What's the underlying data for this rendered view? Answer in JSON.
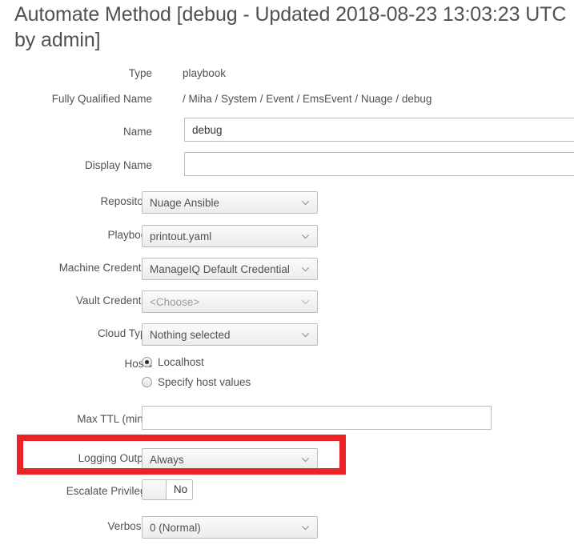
{
  "page": {
    "title": "Automate Method [debug - Updated 2018-08-23 13:03:23 UTC by admin]"
  },
  "colors": {
    "highlight": "#ec2227",
    "label_text": "#4d5258",
    "placeholder_text": "#9c9c9c"
  },
  "form": {
    "type": {
      "label": "Type",
      "value": "playbook"
    },
    "fully_qualified_name": {
      "label": "Fully Qualified Name",
      "value": "/ Miha / System / Event / EmsEvent / Nuage / debug"
    },
    "name": {
      "label": "Name",
      "value": "debug",
      "placeholder": ""
    },
    "display_name": {
      "label": "Display Name",
      "value": "",
      "placeholder": ""
    },
    "repository": {
      "label": "Repository",
      "value": "Nuage Ansible"
    },
    "playbook": {
      "label": "Playbook",
      "value": "printout.yaml"
    },
    "machine_credential": {
      "label": "Machine Credential",
      "value": "ManageIQ Default Credential"
    },
    "vault_credential": {
      "label": "Vault Credential",
      "value": "<Choose>"
    },
    "cloud_type": {
      "label": "Cloud Type",
      "value": "Nothing selected"
    },
    "hosts": {
      "label": "Hosts",
      "options": [
        {
          "label": "Localhost",
          "selected": true
        },
        {
          "label": "Specify host values",
          "selected": false
        }
      ]
    },
    "max_ttl": {
      "label": "Max TTL (mins)",
      "value": "",
      "placeholder": ""
    },
    "logging_output": {
      "label": "Logging Output",
      "value": "Always"
    },
    "escalate_privilege": {
      "label": "Escalate Privilege",
      "value": "No"
    },
    "verbosity": {
      "label": "Verbosity",
      "value": "0 (Normal)"
    }
  }
}
